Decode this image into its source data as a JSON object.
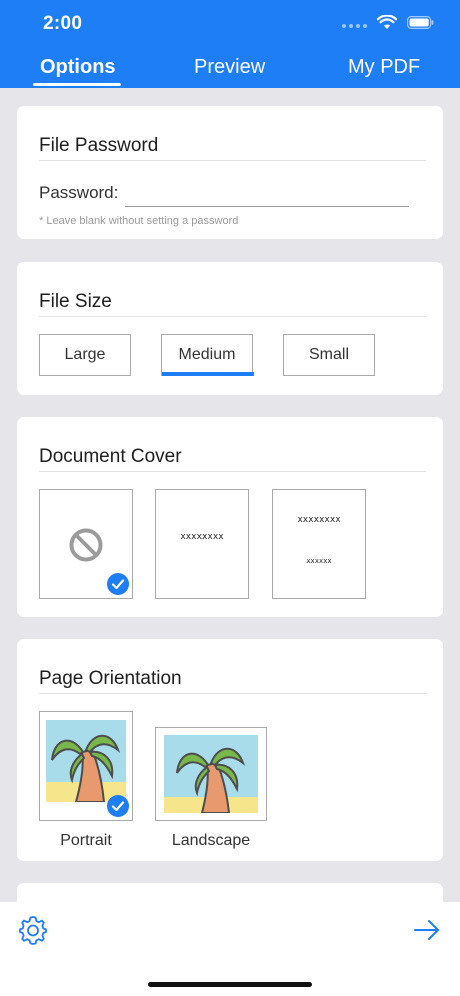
{
  "status": {
    "time": "2:00"
  },
  "tabs": [
    {
      "label": "Options",
      "active": true
    },
    {
      "label": "Preview",
      "active": false
    },
    {
      "label": "My PDF",
      "active": false
    }
  ],
  "password_card": {
    "title": "File Password",
    "label": "Password:",
    "value": "",
    "hint": "* Leave blank without setting a password"
  },
  "size_card": {
    "title": "File Size",
    "options": [
      "Large",
      "Medium",
      "Small"
    ],
    "selected": "Medium"
  },
  "cover_card": {
    "title": "Document Cover",
    "options": [
      {
        "type": "none",
        "selected": true
      },
      {
        "type": "title",
        "line1": "xxxxxxxx"
      },
      {
        "type": "title-subtitle",
        "line1": "xxxxxxxx",
        "line2": "xxxxxx"
      }
    ]
  },
  "orientation_card": {
    "title": "Page Orientation",
    "options": [
      "Portrait",
      "Landscape"
    ],
    "selected": "Portrait"
  },
  "colors": {
    "accent": "#1d7ef5",
    "background": "#e6e6ea"
  },
  "toolbar": {
    "left_icon": "gear-icon",
    "right_icon": "arrow-right-icon"
  }
}
